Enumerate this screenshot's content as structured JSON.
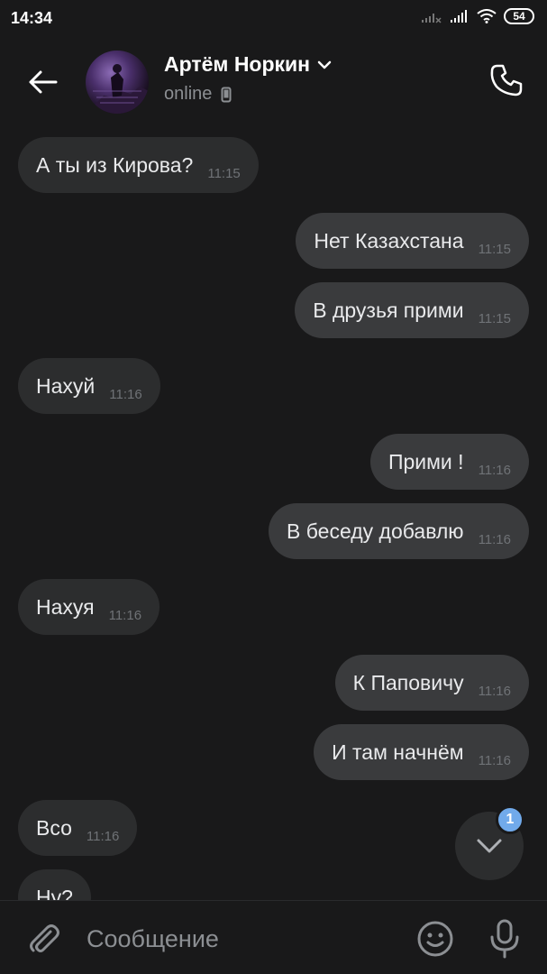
{
  "status_bar": {
    "time": "14:34",
    "battery": "54"
  },
  "header": {
    "contact_name": "Артём Норкин",
    "status": "online"
  },
  "messages": [
    {
      "text": "А ты из Кирова?",
      "time": "11:15",
      "direction": "in"
    },
    {
      "text": "Нет Казахстана",
      "time": "11:15",
      "direction": "out"
    },
    {
      "text": "В друзья прими",
      "time": "11:15",
      "direction": "out"
    },
    {
      "text": "Нахуй",
      "time": "11:16",
      "direction": "in"
    },
    {
      "text": "Прими !",
      "time": "11:16",
      "direction": "out"
    },
    {
      "text": "В беседу добавлю",
      "time": "11:16",
      "direction": "out"
    },
    {
      "text": "Нахуя",
      "time": "11:16",
      "direction": "in"
    },
    {
      "text": "К Паповичу",
      "time": "11:16",
      "direction": "out"
    },
    {
      "text": "И там начнём",
      "time": "11:16",
      "direction": "out"
    },
    {
      "text": "Всо",
      "time": "11:16",
      "direction": "in"
    },
    {
      "text": "Ну?",
      "time": "",
      "direction": "in"
    }
  ],
  "scroll_down": {
    "unread_count": "1"
  },
  "composer": {
    "placeholder": "Сообщение"
  },
  "icons": {
    "back": "back-arrow-icon",
    "call": "phone-icon",
    "attach": "paperclip-icon",
    "emoji": "smiley-icon",
    "mic": "microphone-icon",
    "scroll": "chevron-down-icon"
  },
  "colors": {
    "background": "#19191a",
    "bubble_in": "#2c2d2e",
    "bubble_out": "#3a3b3d",
    "badge": "#71aaeb"
  }
}
